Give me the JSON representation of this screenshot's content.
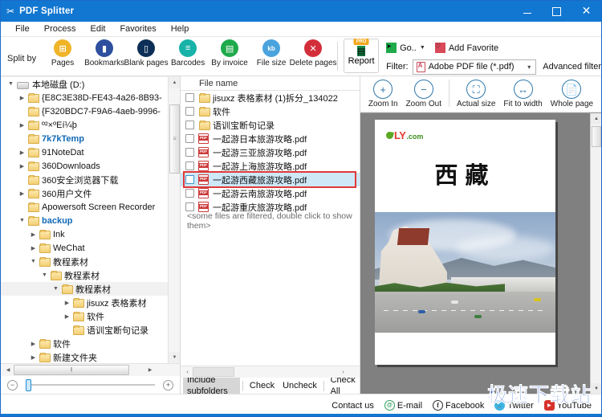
{
  "window": {
    "title": "PDF Splitter",
    "app_icon": "scissors-icon",
    "minimize": "–",
    "maximize": "□",
    "close": "✕"
  },
  "menu": {
    "items": [
      "File",
      "Process",
      "Edit",
      "Favorites",
      "Help"
    ]
  },
  "ribbon": {
    "split_by_label": "Split by",
    "tools": [
      {
        "label": "Pages",
        "icon": "pages-icon",
        "color": "#f0b429",
        "glyph": "⊞"
      },
      {
        "label": "Bookmarks",
        "icon": "bookmarks-icon",
        "color": "#2d4f9e",
        "glyph": "▮"
      },
      {
        "label": "Blank pages",
        "icon": "blank-pages-icon",
        "color": "#0d2f57",
        "glyph": "▯"
      },
      {
        "label": "Barcodes",
        "icon": "barcodes-icon",
        "color": "#17b2a8",
        "glyph": "≡"
      },
      {
        "label": "By invoice",
        "icon": "invoice-icon",
        "color": "#1faa4b",
        "glyph": "▤"
      },
      {
        "label": "File size",
        "icon": "file-size-icon",
        "color": "#4aa3dd",
        "glyph": "kb"
      },
      {
        "label": "Delete pages",
        "icon": "delete-pages-icon",
        "color": "#d32f3a",
        "glyph": "✕"
      }
    ],
    "report": {
      "label": "Report",
      "badge": "PRO",
      "icon": "report-icon",
      "color": "#1a8a4a",
      "glyph": "▤"
    },
    "go": {
      "label": "Go..",
      "icon": "go-arrow-icon",
      "caret": "▼"
    },
    "add_favorite": {
      "label": "Add Favorite",
      "icon": "heart-icon"
    },
    "filter": {
      "label": "Filter:",
      "value": "Adobe PDF file (*.pdf)",
      "arrow": "⌄",
      "icon": "adobe-pdf-icon"
    },
    "advanced_filter": "Advanced filter"
  },
  "tree": {
    "items": [
      {
        "label": "本地磁盘 (D:)",
        "indent": 0,
        "twist": "d",
        "icon": "drive-icon",
        "blue": false
      },
      {
        "label": "{E8C3E38D-FE43-4a26-8B93-",
        "indent": 1,
        "twist": "r",
        "icon": "folder-icon",
        "blue": false
      },
      {
        "label": "{F320BDC7-F9A6-4aeb-9996-",
        "indent": 1,
        "twist": "",
        "icon": "folder-icon",
        "blue": false
      },
      {
        "label": "º²×ºEí¼þ",
        "indent": 1,
        "twist": "r",
        "icon": "folder-icon",
        "blue": false
      },
      {
        "label": "7k7kTemp",
        "indent": 1,
        "twist": "",
        "icon": "folder-icon",
        "blue": true
      },
      {
        "label": "91NoteDat",
        "indent": 1,
        "twist": "r",
        "icon": "folder-icon",
        "blue": false
      },
      {
        "label": "360Downloads",
        "indent": 1,
        "twist": "r",
        "icon": "folder-icon",
        "blue": false
      },
      {
        "label": "360安全浏览器下载",
        "indent": 1,
        "twist": "",
        "icon": "folder-icon",
        "blue": false
      },
      {
        "label": "360用户文件",
        "indent": 1,
        "twist": "r",
        "icon": "folder-icon",
        "blue": false
      },
      {
        "label": "Apowersoft Screen Recorder",
        "indent": 1,
        "twist": "",
        "icon": "folder-icon",
        "blue": false
      },
      {
        "label": "backup",
        "indent": 1,
        "twist": "d",
        "icon": "folder-icon",
        "blue": true
      },
      {
        "label": "Ink",
        "indent": 2,
        "twist": "r",
        "icon": "folder-icon",
        "blue": false
      },
      {
        "label": "WeChat",
        "indent": 2,
        "twist": "r",
        "icon": "folder-icon",
        "blue": false
      },
      {
        "label": "教程素材",
        "indent": 2,
        "twist": "d",
        "icon": "folder-icon",
        "blue": false
      },
      {
        "label": "教程素材",
        "indent": 3,
        "twist": "d",
        "icon": "folder-icon",
        "blue": false
      },
      {
        "label": "教程素材",
        "indent": 4,
        "twist": "d",
        "icon": "folder-icon",
        "blue": false,
        "selected": true
      },
      {
        "label": "jisuxz 表格素材",
        "indent": 5,
        "twist": "r",
        "icon": "folder-icon",
        "blue": false
      },
      {
        "label": "软件",
        "indent": 5,
        "twist": "r",
        "icon": "folder-icon",
        "blue": false
      },
      {
        "label": "语训宝断句记录",
        "indent": 5,
        "twist": "",
        "icon": "folder-icon",
        "blue": false
      },
      {
        "label": "软件",
        "indent": 2,
        "twist": "r",
        "icon": "folder-icon",
        "blue": false
      },
      {
        "label": "新建文件夹",
        "indent": 2,
        "twist": "r",
        "icon": "folder-icon",
        "blue": false
      }
    ],
    "scroll_up": "▲",
    "scroll_down": "▼",
    "hscroll_left": "◀",
    "hscroll_right": "▶"
  },
  "zoom_slider": {
    "minus": "−",
    "plus": "+"
  },
  "filelist": {
    "header": "File name",
    "rows": [
      {
        "label": "jisuxz 表格素材 (1)拆分_134022",
        "type": "folder",
        "checked": false,
        "selected": false
      },
      {
        "label": "软件",
        "type": "folder",
        "checked": false,
        "selected": false
      },
      {
        "label": "语训宝断句记录",
        "type": "folder",
        "checked": false,
        "selected": false
      },
      {
        "label": "一起游日本旅游攻略.pdf",
        "type": "pdf",
        "checked": false,
        "selected": false
      },
      {
        "label": "一起游三亚旅游攻略.pdf",
        "type": "pdf",
        "checked": false,
        "selected": false
      },
      {
        "label": "一起游上海旅游攻略.pdf",
        "type": "pdf",
        "checked": false,
        "selected": false
      },
      {
        "label": "一起游西藏旅游攻略.pdf",
        "type": "pdf",
        "checked": false,
        "selected": true
      },
      {
        "label": "一起游云南旅游攻略.pdf",
        "type": "pdf",
        "checked": false,
        "selected": false
      },
      {
        "label": "一起游重庆旅游攻略.pdf",
        "type": "pdf",
        "checked": false,
        "selected": false
      }
    ],
    "filtered_note": "<some files are filtered, double click to show them>",
    "buttons": [
      {
        "label": "Include subfolders",
        "active": true
      },
      {
        "label": "Check",
        "active": false
      },
      {
        "label": "Uncheck",
        "active": false
      },
      {
        "label": "Check All",
        "active": false
      }
    ],
    "hscroll_left": "‹",
    "hscroll_right": "›"
  },
  "preview": {
    "tools": [
      {
        "label": "Zoom In",
        "icon": "zoom-in-icon",
        "glyph": "+"
      },
      {
        "label": "Zoom Out",
        "icon": "zoom-out-icon",
        "glyph": "−"
      },
      {
        "label": "Actual size",
        "icon": "actual-size-icon",
        "glyph": "⛶"
      },
      {
        "label": "Fit to width",
        "icon": "fit-to-width-icon",
        "glyph": "↔"
      },
      {
        "label": "Whole page",
        "icon": "whole-page-icon",
        "glyph": "⬚"
      }
    ],
    "page": {
      "logo_brand": "LY",
      "logo_suffix": ".com",
      "title": "西藏"
    },
    "scroll_up": "▲",
    "scroll_down": "▼"
  },
  "footer": {
    "contact_us": "Contact us",
    "links": [
      {
        "label": "E-mail",
        "icon": "email-icon",
        "glyph": "@"
      },
      {
        "label": "Facebook",
        "icon": "facebook-icon",
        "glyph": "f"
      },
      {
        "label": "Twitter",
        "icon": "twitter-icon",
        "glyph": "t"
      },
      {
        "label": "YouTube",
        "icon": "youtube-icon",
        "glyph": "▶"
      }
    ]
  },
  "watermark": {
    "text": "极速下载站",
    "color": "#2b5fd0"
  }
}
